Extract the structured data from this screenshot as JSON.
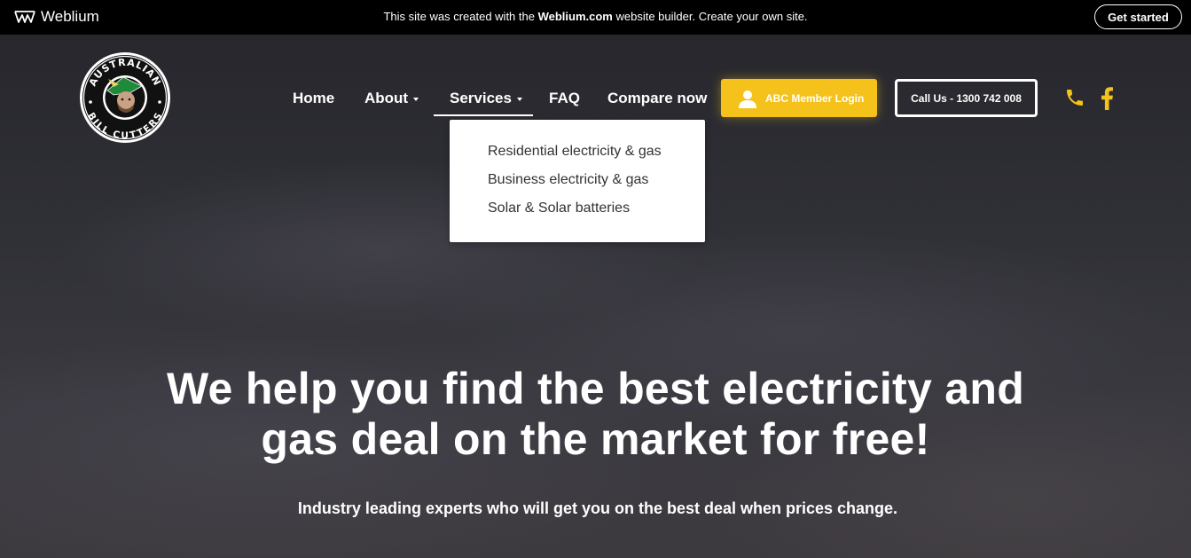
{
  "promo_bar": {
    "brand": "Weblium",
    "message_pre": "This site was created with the ",
    "message_brand": "Weblium.com",
    "message_post": " website builder. Create your own site.",
    "cta": "Get started"
  },
  "logo": {
    "top_text": "AUSTRALIAN",
    "bottom_text": "BILL CUTTERS"
  },
  "nav": {
    "items": [
      {
        "label": "Home"
      },
      {
        "label": "About"
      },
      {
        "label": "Services"
      },
      {
        "label": "FAQ"
      },
      {
        "label": "Compare now"
      }
    ],
    "login_button": "ABC Member Login",
    "call_button": "Call Us - 1300 742 008",
    "phone_icon": "phone-icon",
    "facebook_icon": "facebook-icon"
  },
  "services_dropdown": {
    "items": [
      "Residential electricity & gas",
      "Business electricity & gas",
      "Solar & Solar batteries"
    ]
  },
  "hero": {
    "headline_line1": "We help you find the best electricity and",
    "headline_line2": "gas deal on the market for free!",
    "subheadline": "Industry leading experts who will get you on the best deal when prices change."
  },
  "colors": {
    "accent": "#f5c21b",
    "promo_bg": "#000000",
    "hero_bg": "#2f2f36",
    "logo_green": "#1f8a3a"
  }
}
